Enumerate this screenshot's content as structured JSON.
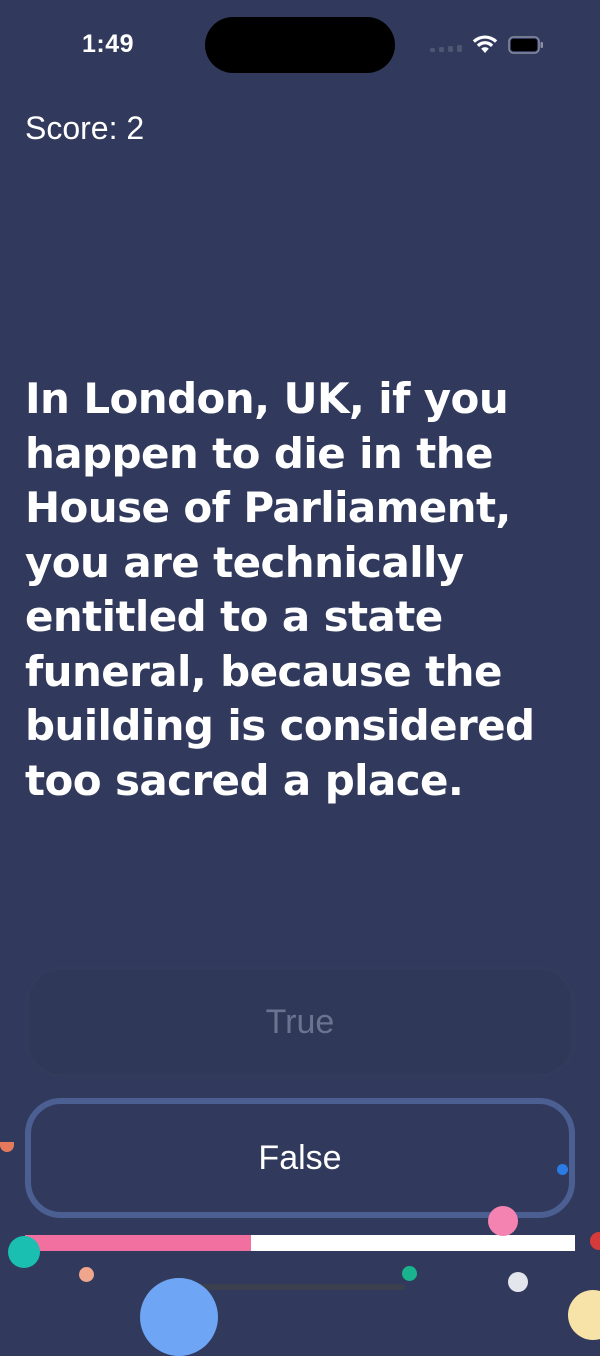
{
  "status_bar": {
    "time": "1:49",
    "icons": [
      "cellular-signal-icon",
      "wifi-icon",
      "battery-icon"
    ]
  },
  "score": {
    "label": "Score: 2"
  },
  "question": {
    "text": "In London, UK, if you happen to die in the House of Parliament, you are technically entitled to a state funeral, because the building is considered too sacred a place."
  },
  "answers": {
    "true_label": "True",
    "false_label": "False"
  },
  "progress": {
    "fraction": 0.41
  },
  "colors": {
    "background": "#313a5c",
    "false_border": "#4b5f92",
    "progress_fill": "#f2709f",
    "progress_track": "#ffffff"
  },
  "decorations": [
    "confetti"
  ]
}
